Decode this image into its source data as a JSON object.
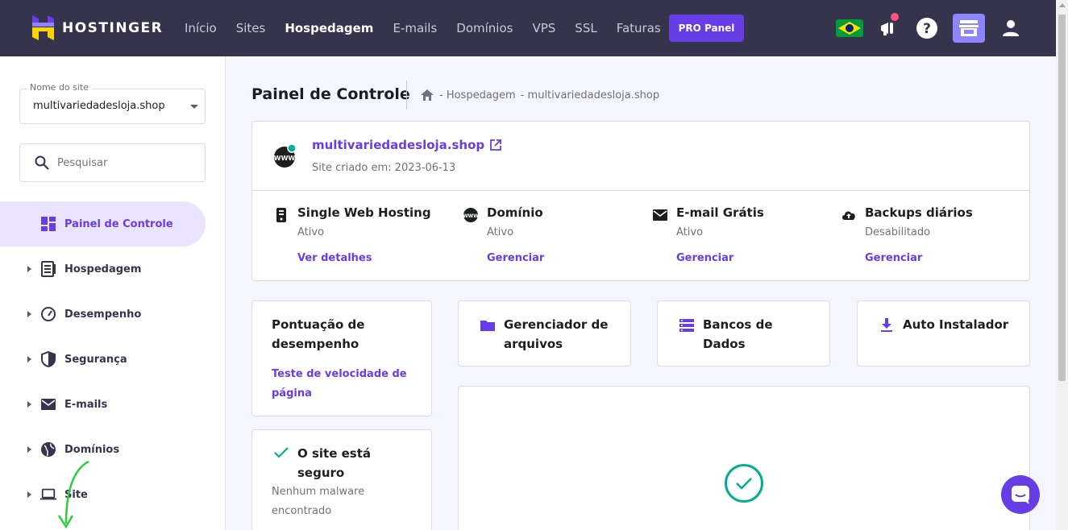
{
  "brand": {
    "name": "HOSTINGER"
  },
  "nav": {
    "links": [
      "Início",
      "Sites",
      "Hospedagem",
      "E-mails",
      "Domínios",
      "VPS",
      "SSL",
      "Faturas"
    ],
    "active": "Hospedagem",
    "pro_label": "PRO Panel"
  },
  "sidebar": {
    "site_select_label": "Nome do site",
    "site_select_value": "multivariedadesloja.shop",
    "search_placeholder": "Pesquisar",
    "items": [
      {
        "label": "Painel de Controle",
        "icon": "dashboard-icon",
        "active": true
      },
      {
        "label": "Hospedagem",
        "icon": "hosting-icon"
      },
      {
        "label": "Desempenho",
        "icon": "speedometer-icon"
      },
      {
        "label": "Segurança",
        "icon": "shield-icon"
      },
      {
        "label": "E-mails",
        "icon": "mail-icon"
      },
      {
        "label": "Domínios",
        "icon": "globe-icon"
      },
      {
        "label": "Site",
        "icon": "laptop-icon"
      }
    ]
  },
  "main": {
    "title": "Painel de Controle",
    "breadcrumb": [
      "- Hospedagem",
      "- multivariedadesloja.shop"
    ],
    "site": {
      "domain": "multivariedadesloja.shop",
      "created": "Site criado em: 2023-06-13",
      "features": [
        {
          "title": "Single Web Hosting",
          "status": "Ativo",
          "link": "Ver detalhes",
          "icon": "server-icon"
        },
        {
          "title": "Domínio",
          "status": "Ativo",
          "link": "Gerenciar",
          "icon": "www-icon"
        },
        {
          "title": "E-mail Grátis",
          "status": "Ativo",
          "link": "Gerenciar",
          "icon": "mail-icon"
        },
        {
          "title": "Backups diários",
          "status": "Desabilitado",
          "link": "Gerenciar",
          "icon": "cloud-upload-icon"
        }
      ]
    },
    "performance": {
      "title": "Pontuação de desempenho",
      "link": "Teste de velocidade de página"
    },
    "security": {
      "title": "O site está seguro",
      "desc": "Nenhum malware encontrado"
    },
    "tools": [
      {
        "label": "Gerenciador de arquivos",
        "icon": "folder-icon"
      },
      {
        "label": "Bancos de Dados",
        "icon": "database-icon"
      },
      {
        "label": "Auto Instalador",
        "icon": "download-icon"
      }
    ]
  },
  "colors": {
    "accent": "#673de6",
    "nav_bg": "#36344d",
    "success": "#00b090"
  }
}
